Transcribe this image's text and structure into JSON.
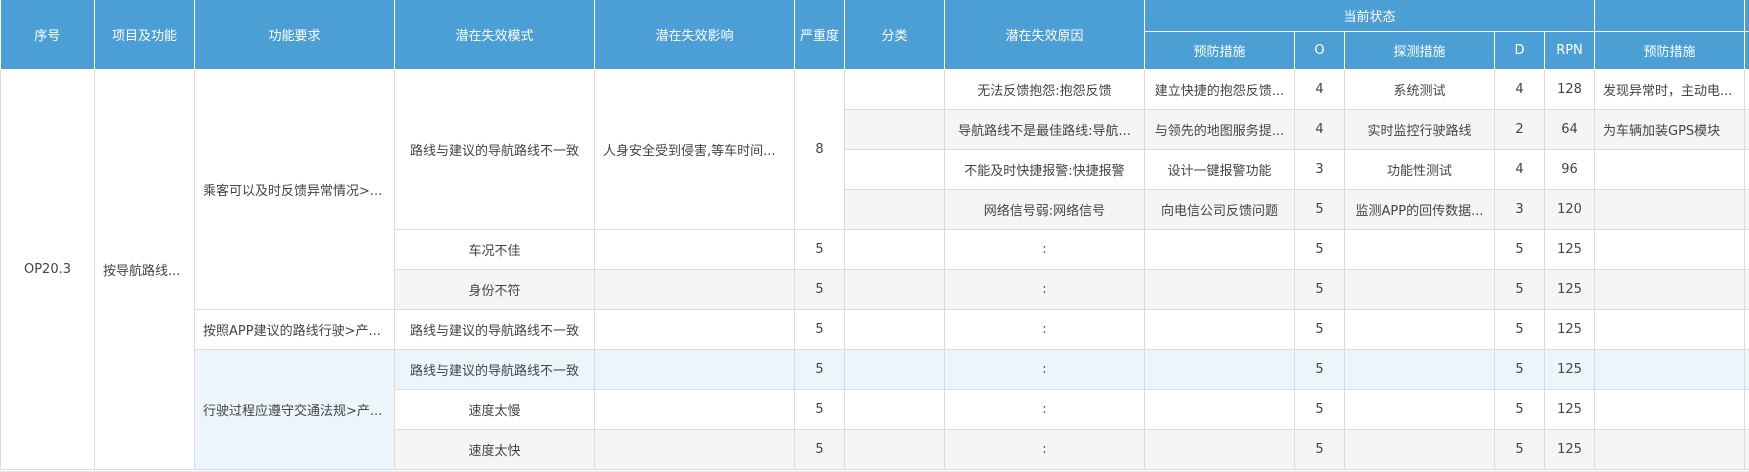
{
  "headers": {
    "seq": "序号",
    "item_function": "项目及功能",
    "func_req": "功能要求",
    "failure_mode": "潜在失效模式",
    "failure_effect": "潜在失效影响",
    "severity": "严重度",
    "classification": "分类",
    "failure_cause": "潜在失效原因",
    "current_status": "当前状态",
    "prevention": "预防措施",
    "o": "O",
    "detection": "探测措施",
    "d": "D",
    "rpn": "RPN",
    "recommended_prevention": "预防措施"
  },
  "merged": {
    "seq": "OP20.3",
    "item_function": "按导航路线...",
    "func_req_1": "乘客可以及时反馈异常情况>...",
    "func_req_2": "按照APP建议的路线行驶>产...",
    "func_req_3": "行驶过程应遵守交通法规>产...",
    "mode_1": "路线与建议的导航路线不一致",
    "effect_1": "人身安全受到侵害,等车时间...",
    "severity_1": "8"
  },
  "rows": [
    {
      "mode": "",
      "effect": "",
      "severity": "",
      "class": "",
      "cause": "无法反馈抱怨:抱怨反馈",
      "prevention": "建立快捷的抱怨反馈...",
      "o": "4",
      "detection": "系统测试",
      "d": "4",
      "rpn": "128",
      "rec": "发现异常时，主动电..."
    },
    {
      "mode": "",
      "effect": "",
      "severity": "",
      "class": "",
      "cause": "导航路线不是最佳路线:导航...",
      "prevention": "与领先的地图服务提...",
      "o": "4",
      "detection": "实时监控行驶路线",
      "d": "2",
      "rpn": "64",
      "rec": "为车辆加装GPS模块"
    },
    {
      "mode": "",
      "effect": "",
      "severity": "",
      "class": "",
      "cause": "不能及时快捷报警:快捷报警",
      "prevention": "设计一键报警功能",
      "o": "3",
      "detection": "功能性测试",
      "d": "4",
      "rpn": "96",
      "rec": ""
    },
    {
      "mode": "",
      "effect": "",
      "severity": "",
      "class": "",
      "cause": "网络信号弱:网络信号",
      "prevention": "向电信公司反馈问题",
      "o": "5",
      "detection": "监测APP的回传数据...",
      "d": "3",
      "rpn": "120",
      "rec": ""
    },
    {
      "mode": "车况不佳",
      "effect": "",
      "severity": "5",
      "class": "",
      "cause": ":",
      "prevention": "",
      "o": "5",
      "detection": "",
      "d": "5",
      "rpn": "125",
      "rec": ""
    },
    {
      "mode": "身份不符",
      "effect": "",
      "severity": "5",
      "class": "",
      "cause": ":",
      "prevention": "",
      "o": "5",
      "detection": "",
      "d": "5",
      "rpn": "125",
      "rec": ""
    },
    {
      "mode": "路线与建议的导航路线不一致",
      "effect": "",
      "severity": "5",
      "class": "",
      "cause": ":",
      "prevention": "",
      "o": "5",
      "detection": "",
      "d": "5",
      "rpn": "125",
      "rec": ""
    },
    {
      "mode": "路线与建议的导航路线不一致",
      "effect": "",
      "severity": "5",
      "class": "",
      "cause": ":",
      "prevention": "",
      "o": "5",
      "detection": "",
      "d": "5",
      "rpn": "125",
      "rec": ""
    },
    {
      "mode": "速度太慢",
      "effect": "",
      "severity": "5",
      "class": "",
      "cause": ":",
      "prevention": "",
      "o": "5",
      "detection": "",
      "d": "5",
      "rpn": "125",
      "rec": ""
    },
    {
      "mode": "速度太快",
      "effect": "",
      "severity": "5",
      "class": "",
      "cause": ":",
      "prevention": "",
      "o": "5",
      "detection": "",
      "d": "5",
      "rpn": "125",
      "rec": ""
    }
  ]
}
